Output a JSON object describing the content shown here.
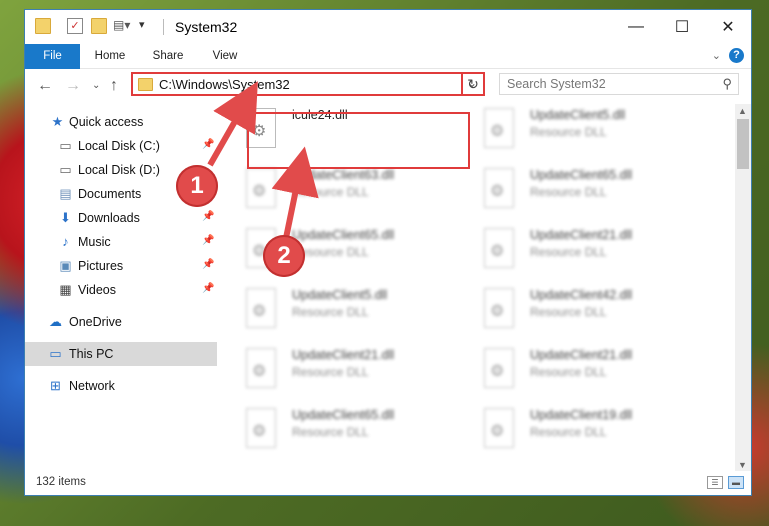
{
  "window": {
    "title": "System32",
    "controls": {
      "minimize": "—",
      "maximize": "☐",
      "close": "✕"
    }
  },
  "ribbon": {
    "tabs": [
      "File",
      "Home",
      "Share",
      "View"
    ]
  },
  "nav": {
    "address": "C:\\Windows\\System32",
    "search_placeholder": "Search System32"
  },
  "sidebar": {
    "items": [
      {
        "label": "Quick access",
        "icon": "star-icon"
      },
      {
        "label": "Local Disk (C:)",
        "icon": "drive-icon"
      },
      {
        "label": "Local Disk (D:)",
        "icon": "drive-icon"
      },
      {
        "label": "Documents",
        "icon": "documents-icon"
      },
      {
        "label": "Downloads",
        "icon": "download-icon"
      },
      {
        "label": "Music",
        "icon": "music-icon"
      },
      {
        "label": "Pictures",
        "icon": "pictures-icon"
      },
      {
        "label": "Videos",
        "icon": "videos-icon"
      },
      {
        "label": "OneDrive",
        "icon": "cloud-icon"
      },
      {
        "label": "This PC",
        "icon": "computer-icon"
      },
      {
        "label": "Network",
        "icon": "network-icon"
      }
    ]
  },
  "files": [
    {
      "name": "icule24.dll",
      "type": ""
    },
    {
      "name": "UpdateClient5.dll",
      "type": "Resource DLL"
    },
    {
      "name": "UpdateClient63.dll",
      "type": "Resource DLL"
    },
    {
      "name": "UpdateClient65.dll",
      "type": "Resource DLL"
    },
    {
      "name": "UpdateClient65.dll",
      "type": "Resource DLL"
    },
    {
      "name": "UpdateClient21.dll",
      "type": "Resource DLL"
    },
    {
      "name": "UpdateClient5.dll",
      "type": "Resource DLL"
    },
    {
      "name": "UpdateClient42.dll",
      "type": "Resource DLL"
    },
    {
      "name": "UpdateClient21.dll",
      "type": "Resource DLL"
    },
    {
      "name": "UpdateClient21.dll",
      "type": "Resource DLL"
    },
    {
      "name": "UpdateClient65.dll",
      "type": "Resource DLL"
    },
    {
      "name": "UpdateClient19.dll",
      "type": "Resource DLL"
    }
  ],
  "status": {
    "item_count": "132 items"
  },
  "annotations": {
    "step1": "1",
    "step2": "2"
  },
  "colors": {
    "accent": "#1979ca",
    "highlight": "#e03b3b"
  }
}
